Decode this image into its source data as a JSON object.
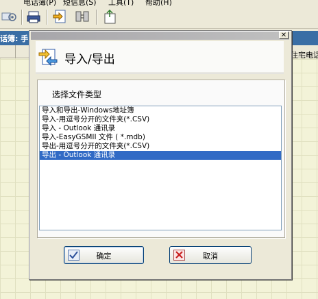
{
  "app": {
    "menu": [
      "电话簿(P)",
      "短信息(S)",
      "工具(T)",
      "帮助(H)"
    ],
    "title": "话簿: 手",
    "column_right": "住宅电话"
  },
  "dialog": {
    "close_symbol": "✕",
    "header_title": "导入/导出",
    "group_label": "选择文件类型",
    "list_items": [
      "导入和导出-Windows地址簿",
      "导入-用逗号分开的文件夹(*.CSV)",
      "导入 - Outlook 通讯录",
      "导入-EasyGSMII 文件 ( *.mdb)",
      "导出-用逗号分开的文件夹(*.CSV)",
      "导出 - Outlook 通讯录"
    ],
    "selected_index": 5,
    "ok_label": "确定",
    "cancel_label": "取消"
  },
  "colors": {
    "selection": "#316ac5",
    "app_titlebar": "#3a6ea5",
    "grid_background": "#f3f3d8"
  }
}
